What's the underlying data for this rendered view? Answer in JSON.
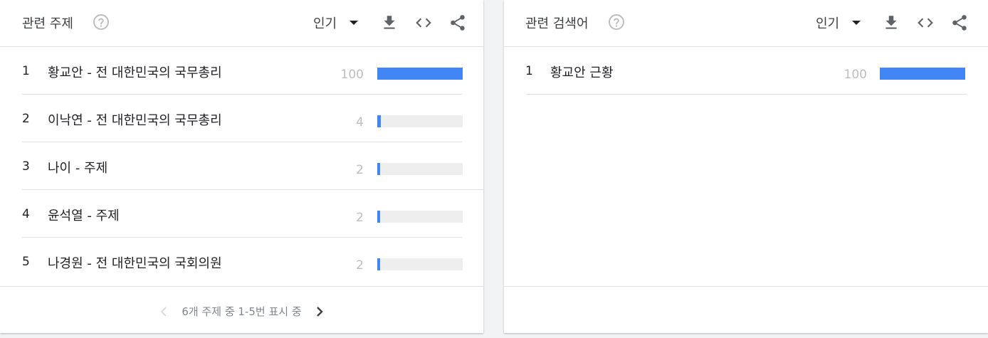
{
  "colors": {
    "bar": "#4285f4",
    "track": "#eeeeee",
    "muted": "#bdbdbd"
  },
  "left_card": {
    "title": "관련 주제",
    "sort_label": "인기",
    "rows": [
      {
        "rank": "1",
        "label": "황교안 - 전 대한민국의 국무총리",
        "value": "100",
        "fill": 1.0
      },
      {
        "rank": "2",
        "label": "이낙연 - 전 대한민국의 국무총리",
        "value": "4",
        "fill": 0.04
      },
      {
        "rank": "3",
        "label": "나이 - 주제",
        "value": "2",
        "fill": 0.02
      },
      {
        "rank": "4",
        "label": "윤석열 - 주제",
        "value": "2",
        "fill": 0.02
      },
      {
        "rank": "5",
        "label": "나경원 - 전 대한민국의 국회의원",
        "value": "2",
        "fill": 0.02
      }
    ],
    "pager_text": "6개 주제 중 1-5번 표시 중"
  },
  "right_card": {
    "title": "관련 검색어",
    "sort_label": "인기",
    "rows": [
      {
        "rank": "1",
        "label": "황교안 근황",
        "value": "100",
        "fill": 1.0
      }
    ]
  },
  "icons": {
    "help": "help-circle-icon",
    "sort": "dropdown-arrow-icon",
    "download": "download-icon",
    "embed": "embed-code-icon",
    "share": "share-icon",
    "prev": "chevron-left-icon",
    "next": "chevron-right-icon"
  }
}
